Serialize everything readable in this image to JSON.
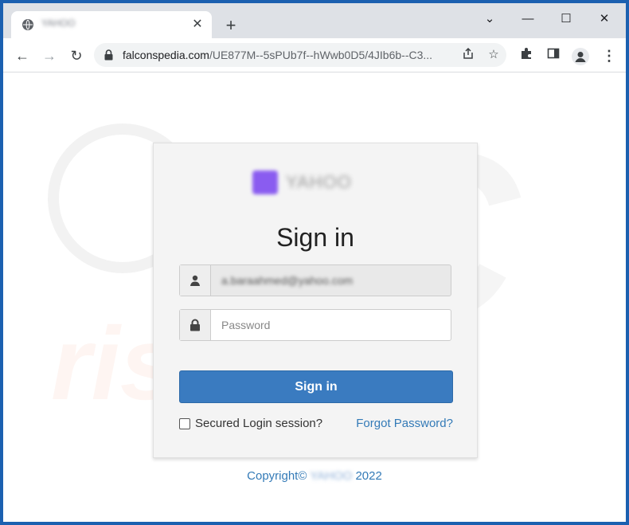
{
  "browser": {
    "tab_title": "YAHOO",
    "tab_close": "✕",
    "new_tab": "+",
    "window_controls": {
      "minimize": "⌄",
      "restore": "—",
      "maximize": "☐",
      "close": "✕"
    },
    "nav": {
      "back": "←",
      "forward": "→",
      "reload": "↻"
    },
    "url_domain": "falconspedia.com",
    "url_path": "/UE877M--5sPUb7f--hWwb0D5/4JIb6b--C3...",
    "menu": "⋮"
  },
  "watermark": {
    "top": "PC",
    "bottom": "risk.com"
  },
  "login": {
    "logo_text": "YAHOO",
    "title": "Sign in",
    "email_value": "a.baraahmed@yahoo.com",
    "password_placeholder": "Password",
    "button_label": "Sign in",
    "remember_label": "Secured Login session?",
    "forgot_label": "Forgot Password?"
  },
  "footer": {
    "prefix": "Copyright©",
    "brand": "YAHOO",
    "year": "2022"
  },
  "colors": {
    "accent": "#3a7bc0",
    "link": "#337ab7",
    "frame": "#1b60b0"
  }
}
